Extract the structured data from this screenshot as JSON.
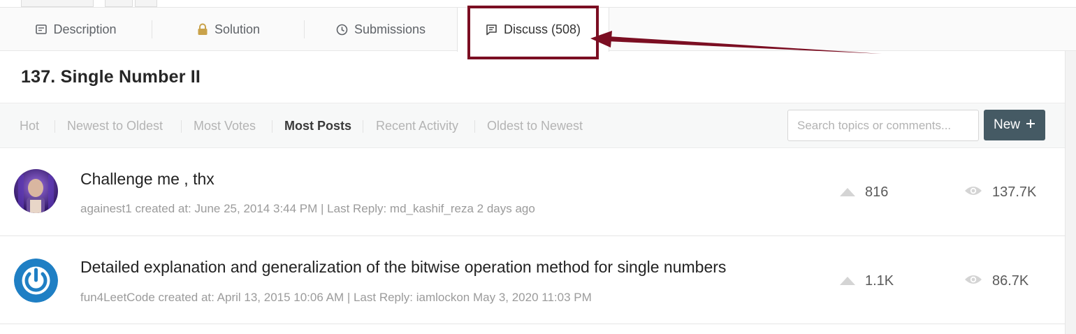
{
  "tabs": [
    {
      "label": "Description",
      "icon": "description-icon"
    },
    {
      "label": "Solution",
      "icon": "lock-icon"
    },
    {
      "label": "Submissions",
      "icon": "clock-icon"
    },
    {
      "label": "Discuss (508)",
      "icon": "comment-icon",
      "active": true
    }
  ],
  "problem": {
    "title": "137. Single Number II"
  },
  "sort_options": [
    {
      "label": "Hot"
    },
    {
      "label": "Newest to Oldest"
    },
    {
      "label": "Most Votes"
    },
    {
      "label": "Most Posts",
      "active": true
    },
    {
      "label": "Recent Activity"
    },
    {
      "label": "Oldest to Newest"
    }
  ],
  "search": {
    "placeholder": "Search topics or comments..."
  },
  "new_button": {
    "label": "New",
    "icon": "plus-icon"
  },
  "topics": [
    {
      "title": "Challenge me , thx",
      "meta": "againest1 created at: June 25, 2014 3:44 PM | Last Reply: md_kashif_reza 2 days ago",
      "votes": "816",
      "views": "137.7K",
      "avatar": "user-avatar-photo"
    },
    {
      "title": "Detailed explanation and generalization of the bitwise operation method for single numbers",
      "meta": "fun4LeetCode created at: April 13, 2015 10:06 AM | Last Reply: iamlockon May 3, 2020 11:03 PM",
      "votes": "1.1K",
      "views": "86.7K",
      "avatar": "power-logo-avatar"
    }
  ],
  "colors": {
    "annotation": "#7b0e22",
    "new_button_bg": "#455a64",
    "lock_icon": "#c9a24a",
    "avatar_blue": "#1f7fc4"
  }
}
